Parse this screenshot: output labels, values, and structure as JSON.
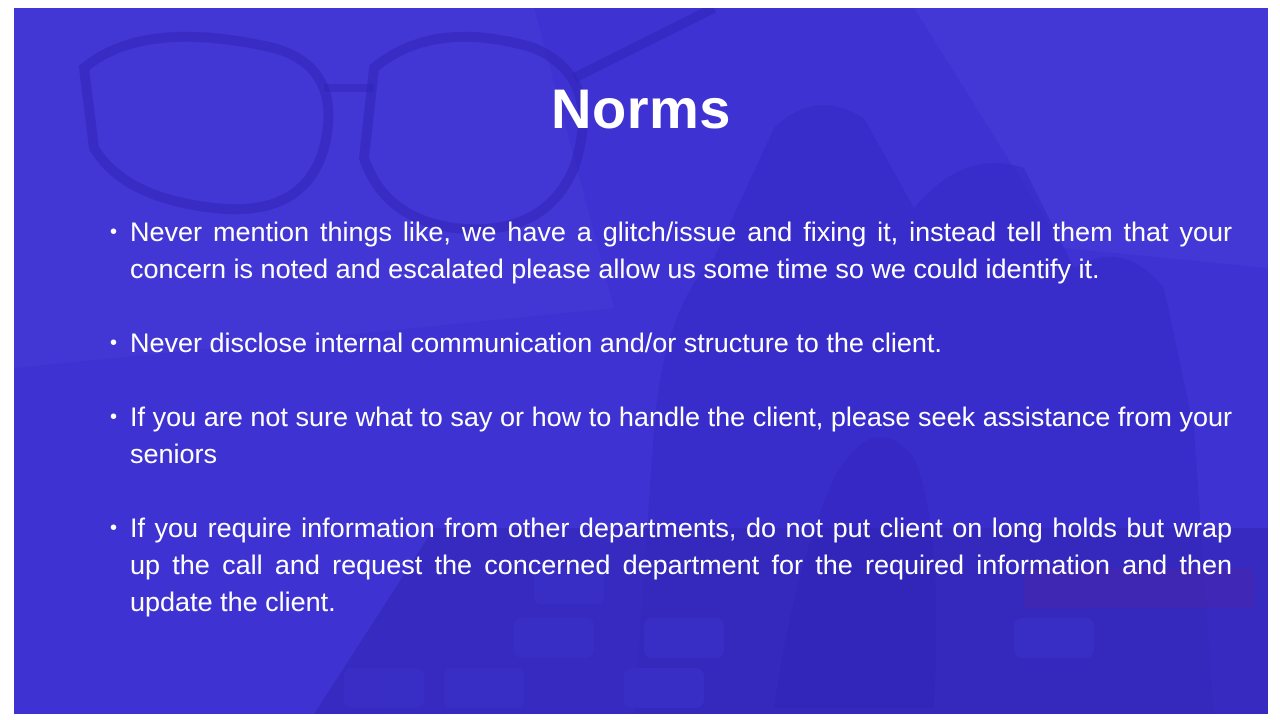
{
  "slide": {
    "title": "Norms",
    "bullets": [
      "Never mention things like, we have a glitch/issue and fixing it, instead tell them that your concern is noted and escalated please allow us some time so we could identify it.",
      "Never disclose internal communication and/or structure to the client.",
      "If you are not sure what to say or how to handle the client, please seek assistance from your seniors",
      "If you require information from other departments, do not put client on long holds but wrap up the call and request the concerned department for the required information and then update the client."
    ],
    "background": {
      "description_icon": "hand-on-calculator-photo",
      "overlay_color": "#3a2fd0"
    }
  }
}
